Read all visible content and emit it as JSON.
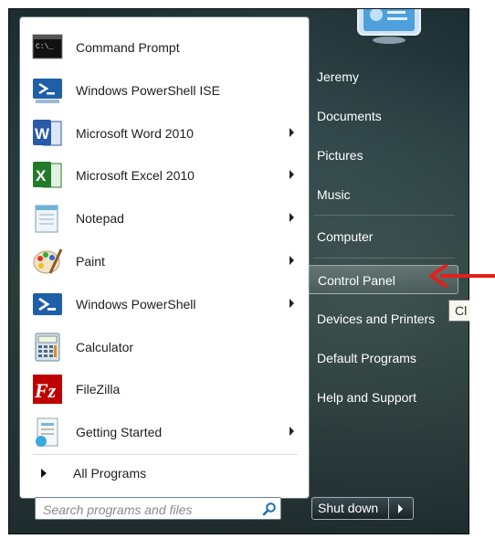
{
  "programs": [
    {
      "label": "Command Prompt",
      "icon": "command-prompt-icon",
      "submenu": false
    },
    {
      "label": "Windows PowerShell ISE",
      "icon": "powershell-ise-icon",
      "submenu": false
    },
    {
      "label": "Microsoft Word 2010",
      "icon": "word-icon",
      "submenu": true
    },
    {
      "label": "Microsoft Excel 2010",
      "icon": "excel-icon",
      "submenu": true
    },
    {
      "label": "Notepad",
      "icon": "notepad-icon",
      "submenu": true
    },
    {
      "label": "Paint",
      "icon": "paint-icon",
      "submenu": true
    },
    {
      "label": "Windows PowerShell",
      "icon": "powershell-icon",
      "submenu": true
    },
    {
      "label": "Calculator",
      "icon": "calculator-icon",
      "submenu": false
    },
    {
      "label": "FileZilla",
      "icon": "filezilla-icon",
      "submenu": false
    },
    {
      "label": "Getting Started",
      "icon": "getting-started-icon",
      "submenu": true
    }
  ],
  "all_programs_label": "All Programs",
  "search": {
    "placeholder": "Search programs and files"
  },
  "right_items": [
    {
      "label": "Jeremy"
    },
    {
      "label": "Documents"
    },
    {
      "label": "Pictures"
    },
    {
      "label": "Music"
    },
    {
      "label": "Computer"
    },
    {
      "label": "Control Panel",
      "selected": true
    },
    {
      "label": "Devices and Printers"
    },
    {
      "label": "Default Programs"
    },
    {
      "label": "Help and Support"
    }
  ],
  "shutdown_label": "Shut down",
  "tooltip_fragment": "Cl",
  "colors": {
    "annotation_arrow": "#e0201b",
    "selected_highlight": "#ffffff"
  }
}
